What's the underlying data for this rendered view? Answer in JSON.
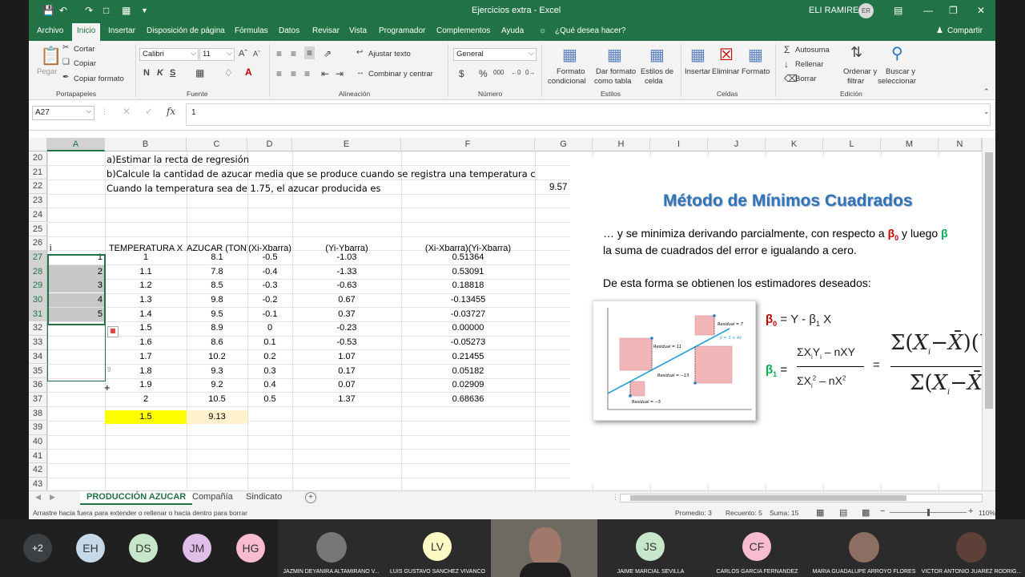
{
  "window": {
    "title": "Ejercicios extra - Excel",
    "user": "ELI RAMIREZ",
    "user_initials": "ER"
  },
  "ribbon_tabs": [
    "Archivo",
    "Inicio",
    "Insertar",
    "Disposición de página",
    "Fórmulas",
    "Datos",
    "Revisar",
    "Vista",
    "Programador",
    "Complementos",
    "Ayuda"
  ],
  "tell_me": "¿Qué desea hacer?",
  "share": "Compartir",
  "ribbon": {
    "paste": "Pegar",
    "cut": "Cortar",
    "copy": "Copiar",
    "format_painter": "Copiar formato",
    "clipboard_group": "Portapapeles",
    "font_name": "Calibri",
    "font_size": "11",
    "font_group": "Fuente",
    "wrap_text": "Ajustar texto",
    "merge_center": "Combinar y centrar",
    "alignment_group": "Alineación",
    "number_format": "General",
    "number_group": "Número",
    "cond_format_1": "Formato",
    "cond_format_2": "condicional",
    "format_table_1": "Dar formato",
    "format_table_2": "como tabla",
    "cell_styles_1": "Estilos de",
    "cell_styles_2": "celda",
    "styles_group": "Estilos",
    "insert": "Insertar",
    "delete": "Eliminar",
    "format": "Formato",
    "cells_group": "Celdas",
    "autosum": "Autosuma",
    "fill": "Rellenar",
    "clear": "Borrar",
    "sort_1": "Ordenar y",
    "sort_2": "filtrar",
    "find_1": "Buscar y",
    "find_2": "seleccionar",
    "editing_group": "Edición"
  },
  "formula_bar": {
    "name_box": "A27",
    "value": "1"
  },
  "columns": [
    "A",
    "B",
    "C",
    "D",
    "E",
    "F",
    "G",
    "H",
    "I",
    "J",
    "K",
    "L",
    "M",
    "N"
  ],
  "rows": [
    "20",
    "21",
    "22",
    "23",
    "24",
    "25",
    "26",
    "27",
    "28",
    "29",
    "30",
    "31",
    "32",
    "33",
    "34",
    "35",
    "36",
    "37",
    "38",
    "39",
    "40",
    "41",
    "42",
    "43"
  ],
  "text_rows": {
    "r20": "a)Estimar la recta de regresión",
    "r21": "b)Calcule la cantidad de azucar media que se produce cuando se registra una temperatura c",
    "r22": "Cuando la temperatura sea de 1.75, el azucar producida es",
    "r22g": "9.57"
  },
  "headers": {
    "a": "i",
    "b": "TEMPERATURA X",
    "c": "AZUCAR (TON)",
    "d": "(Xi-Xbarra)",
    "e": "(Yi-Ybarra)",
    "f": "(Xi-Xbarra)(Yi-Xbarra)"
  },
  "data_rows": [
    [
      "1",
      "1",
      "8.1",
      "-0.5",
      "-1.03",
      "0.51364"
    ],
    [
      "2",
      "1.1",
      "7.8",
      "-0.4",
      "-1.33",
      "0.53091"
    ],
    [
      "3",
      "1.2",
      "8.5",
      "-0.3",
      "-0.63",
      "0.18818"
    ],
    [
      "4",
      "1.3",
      "9.8",
      "-0.2",
      "0.67",
      "-0.13455"
    ],
    [
      "5",
      "1.4",
      "9.5",
      "-0.1",
      "0.37",
      "-0.03727"
    ],
    [
      "",
      "1.5",
      "8.9",
      "0",
      "-0.23",
      "0.00000"
    ],
    [
      "",
      "1.6",
      "8.6",
      "0.1",
      "-0.53",
      "-0.05273"
    ],
    [
      "",
      "1.7",
      "10.2",
      "0.2",
      "1.07",
      "0.21455"
    ],
    [
      "",
      "1.8",
      "9.3",
      "0.3",
      "0.17",
      "0.05182"
    ],
    [
      "",
      "1.9",
      "9.2",
      "0.4",
      "0.07",
      "0.02909"
    ],
    [
      "",
      "2",
      "10.5",
      "0.5",
      "1.37",
      "0.68636"
    ]
  ],
  "means": {
    "b": "1.5",
    "c": "9.13"
  },
  "slide": {
    "title": "Método de Mínimos Cuadrados",
    "line1_a": "… y se minimiza derivando parcialmente, con respecto a ",
    "line1_b": "β",
    "line1_b_sub": "0",
    "line1_c": " y luego ",
    "line1_d": "β",
    "line2": "la suma de cuadrados del error e igualando a cero.",
    "line3": "De esta forma se obtienen los estimadores deseados:",
    "b0_label": "β",
    "b0_sub": "0",
    "b0_eq": " = Y - β",
    "b0_eq_sub": "1",
    "b0_eq_end": " X",
    "b1_label": "β",
    "b1_sub": "1",
    "eq": "=",
    "num": "ΣX",
    "num_i": "i",
    "num_y": "Y",
    "num_tail": " – nXY",
    "den": "ΣX",
    "den_i": "i",
    "den_sup": "2",
    "den_tail": " – nX",
    "den_tail_sup": "2",
    "plot_residual_7": "Residual = 7",
    "plot_residual_11": "Residual = 11",
    "plot_residual_13": "Residual = −13",
    "plot_residual_5": "Residual = −5",
    "plot_eq": "ŷ = 3 + 4x"
  },
  "sheet_tabs": [
    "PRODUCCIÓN AZUCAR",
    "Compañía",
    "Sindicato"
  ],
  "status": {
    "message": "Arrastre hacia fuera para extender o rellenar o hacia dentro para borrar",
    "avg": "Promedio: 3",
    "count": "Recuento: 5",
    "sum": "Suma: 15",
    "zoom": "110%"
  },
  "meet": {
    "more": "+2",
    "avatars": [
      "EH",
      "DS",
      "JM",
      "HG"
    ],
    "tiles": [
      {
        "name": "JAZMIN DEYANIRA ALTAMIRANO V...",
        "initials": ""
      },
      {
        "name": "LUIS GUSTAVO SANCHEZ VIVANCO",
        "initials": "LV"
      },
      {
        "name": "JAIME MARCIAL SEVILLA",
        "initials": "JS"
      },
      {
        "name": "CARLOS GARCIA FERNANDEZ",
        "initials": "CF"
      },
      {
        "name": "MARIA GUADALUPE ARROYO FLORES",
        "initials": ""
      },
      {
        "name": "VICTOR ANTONIO JUAREZ RODRIG...",
        "initials": ""
      }
    ]
  },
  "colors": {
    "excel_green": "#217346",
    "selection_gray": "#c8c8c8",
    "yellow": "#ffff00",
    "slide_title": "#2e75b6",
    "beta_red": "#c00000",
    "beta_green": "#00b050",
    "residual_pink": "#f2b6b9"
  }
}
